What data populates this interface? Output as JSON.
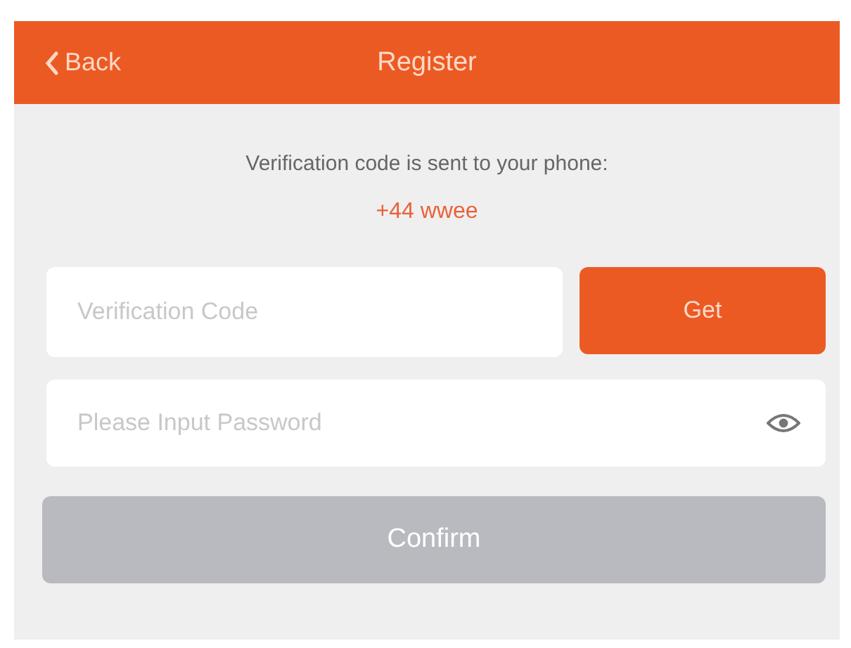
{
  "header": {
    "back": "Back",
    "title": "Register"
  },
  "message": "Verification code is sent to your phone:",
  "phone": "+44 wwee",
  "code_field": {
    "placeholder": "Verification Code"
  },
  "get_button": {
    "label": "Get"
  },
  "password_field": {
    "placeholder": "Please Input Password"
  },
  "confirm_button": {
    "label": "Confirm",
    "disabled": true
  }
}
